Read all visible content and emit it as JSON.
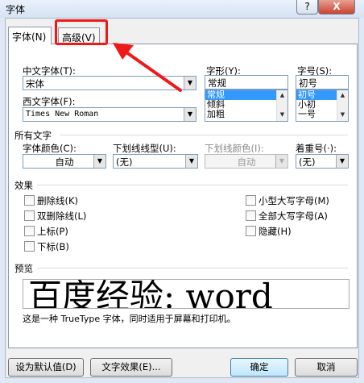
{
  "window": {
    "title": "字体",
    "help_label": "?",
    "close_label": "X"
  },
  "tabs": [
    {
      "label": "字体(N)"
    },
    {
      "label": "高级(V)"
    }
  ],
  "fonts": {
    "chinese_label": "中文字体(T):",
    "chinese_value": "宋体",
    "western_label": "西文字体(F):",
    "western_value": "Times New Roman"
  },
  "style": {
    "label": "字形(Y):",
    "value": "常规",
    "options": [
      "常规",
      "倾斜",
      "加粗"
    ]
  },
  "size": {
    "label": "字号(S):",
    "value": "初号",
    "options": [
      "初号",
      "小初",
      "一号"
    ]
  },
  "all_text": {
    "heading": "所有文字",
    "font_color_label": "字体颜色(C):",
    "font_color_value": "自动",
    "underline_style_label": "下划线线型(U):",
    "underline_style_value": "(无)",
    "underline_color_label": "下划线颜色(I):",
    "underline_color_value": "自动",
    "emphasis_label": "着重号(·):",
    "emphasis_value": "(无)"
  },
  "effects": {
    "heading": "效果",
    "left": [
      "删除线(K)",
      "双删除线(L)",
      "上标(P)",
      "下标(B)"
    ],
    "right": [
      "小型大写字母(M)",
      "全部大写字母(A)",
      "隐藏(H)"
    ]
  },
  "preview": {
    "heading": "预览",
    "sample_text": "百度经验: word",
    "description": "这是一种 TrueType 字体，同时适用于屏幕和打印机。"
  },
  "buttons": {
    "set_default": "设为默认值(D)",
    "text_effects": "文字效果(E)...",
    "ok": "确定",
    "cancel": "取消"
  },
  "colors": {
    "annotation": "#ee1a1a",
    "selection": "#3399ff"
  }
}
